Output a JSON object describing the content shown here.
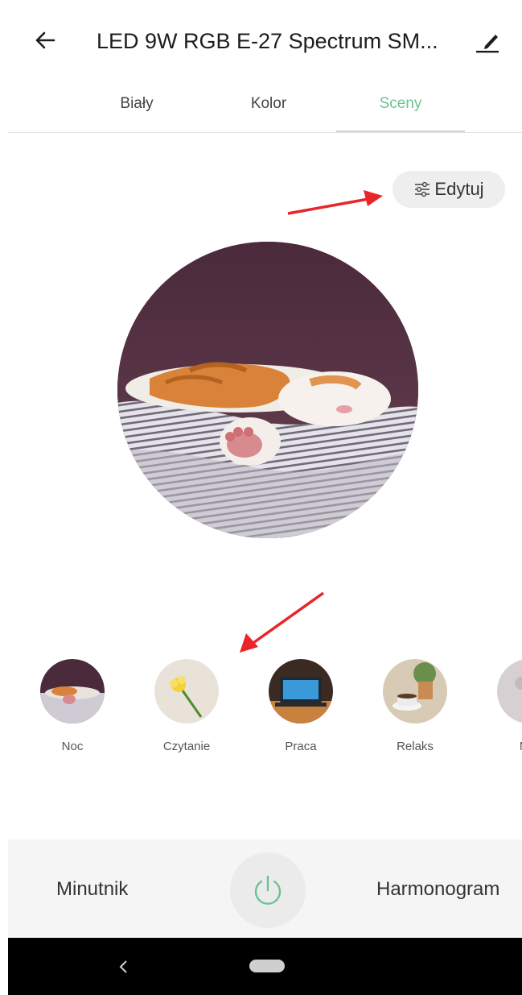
{
  "header": {
    "title": "LED 9W RGB E-27 Spectrum SM...",
    "back_icon": "arrow-left-icon",
    "edit_icon": "pencil-icon"
  },
  "tabs": [
    {
      "label": "Biały",
      "active": false
    },
    {
      "label": "Kolor",
      "active": false
    },
    {
      "label": "Sceny",
      "active": true
    }
  ],
  "scenes_edit": {
    "label": "Edytuj",
    "icon": "sliders-icon"
  },
  "current_scene": {
    "image": "sleeping-cat-photo"
  },
  "scenes": [
    {
      "label": "Noc",
      "image": "sleeping-cat-photo"
    },
    {
      "label": "Czytanie",
      "image": "yellow-flower-photo"
    },
    {
      "label": "Praca",
      "image": "laptop-desk-photo"
    },
    {
      "label": "Relaks",
      "image": "coffee-cup-photo"
    },
    {
      "label": "Mie",
      "image": "moon-photo"
    }
  ],
  "bottom_bar": {
    "left_label": "Minutnik",
    "right_label": "Harmonogram",
    "power_icon": "power-icon"
  },
  "colors": {
    "accent": "#6cc392",
    "annotation_arrow": "#e8262a"
  }
}
